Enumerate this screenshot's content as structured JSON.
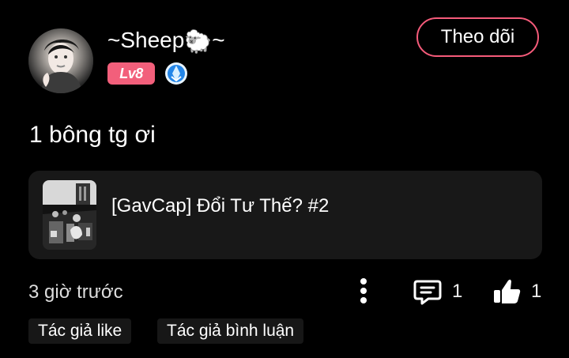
{
  "post": {
    "username": "~Sheep",
    "username_emoji": "🐑",
    "username_suffix": "~",
    "level": "Lv8",
    "follow_label": "Theo dõi",
    "comment_text": "1 bông tg ơi",
    "linked_card": {
      "title": "[GavCap] Đổi Tư Thế? #2"
    },
    "time": "3 giờ trước",
    "comments": "1",
    "likes": "1",
    "tags": [
      "Tác giả like",
      "Tác giả bình luận"
    ]
  },
  "colors": {
    "background": "#000000",
    "accent": "#f55b7a",
    "level": "#f25f7b",
    "card": "#181818",
    "tag": "#171717"
  },
  "icons": [
    "avatar",
    "blue-badge-icon",
    "more-vertical-icon",
    "comment-icon",
    "thumbs-up-icon"
  ]
}
